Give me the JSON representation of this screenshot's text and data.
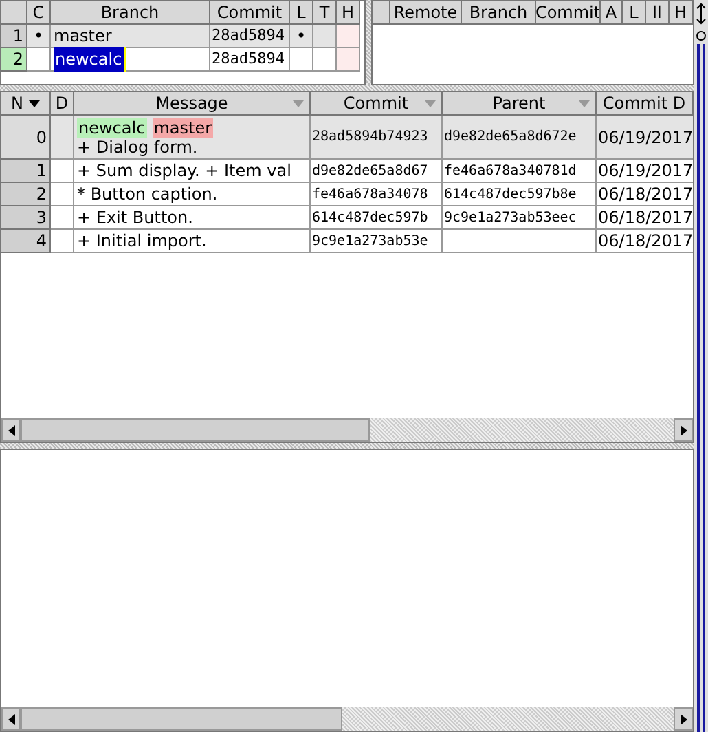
{
  "branches": {
    "columns": [
      {
        "label": "C"
      },
      {
        "label": "Branch"
      },
      {
        "label": "Commit"
      },
      {
        "label": "L"
      },
      {
        "label": "T"
      },
      {
        "label": "H"
      }
    ],
    "rows": [
      {
        "num": "1",
        "current": "•",
        "name": "master",
        "commit": "28ad5894",
        "local": "•",
        "selected": false,
        "editing": false
      },
      {
        "num": "2",
        "name": "newcalc",
        "commit": "28ad5894",
        "selected": true,
        "editing": true
      }
    ]
  },
  "remotes": {
    "columns": [
      {
        "label": "Remote"
      },
      {
        "label": "Branch"
      },
      {
        "label": "Commit"
      },
      {
        "label": "A"
      },
      {
        "label": "L"
      },
      {
        "label": "ll"
      },
      {
        "label": "H"
      }
    ]
  },
  "commits": {
    "columns": [
      {
        "label": "N",
        "sorted": true
      },
      {
        "label": "D",
        "sorted": false
      },
      {
        "label": "Message",
        "sorted": false,
        "filter": true
      },
      {
        "label": "Commit",
        "sorted": false,
        "filter": true
      },
      {
        "label": "Parent",
        "sorted": false,
        "filter": true
      },
      {
        "label": "Commit D",
        "sorted": false,
        "filter": false
      }
    ],
    "rows": [
      {
        "num": "0",
        "refs": [
          {
            "label": "newcalc",
            "color": "#b8f0b8"
          },
          {
            "label": "master",
            "color": "#f4a8a8"
          }
        ],
        "message": "+ Dialog form.",
        "commit": "28ad5894b74923",
        "parent": "d9e82de65a8d672e",
        "date": "06/19/2017",
        "selected": true
      },
      {
        "num": "1",
        "message": "+ Sum display. + Item val",
        "commit": "d9e82de65a8d67",
        "parent": "fe46a678a340781d",
        "date": "06/19/2017",
        "selected": false
      },
      {
        "num": "2",
        "message": "* Button caption.",
        "commit": "fe46a678a34078",
        "parent": "614c487dec597b8e",
        "date": "06/18/2017",
        "selected": false
      },
      {
        "num": "3",
        "message": "+ Exit Button.",
        "commit": "614c487dec597b",
        "parent": "9c9e1a273ab53eec",
        "date": "06/18/2017",
        "selected": false
      },
      {
        "num": "4",
        "message": "+ Initial import.",
        "commit": "9c9e1a273ab53e",
        "date": "06/18/2017",
        "selected": false
      }
    ]
  }
}
